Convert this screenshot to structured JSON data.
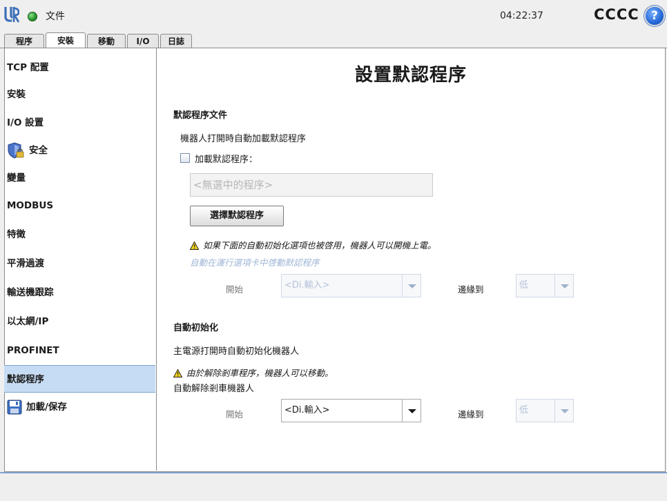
{
  "header": {
    "file_label": "文件",
    "clock": "04:22:37",
    "robot_name": "CCCC",
    "help_symbol": "?",
    "status_color": "#2b9a2f"
  },
  "tabs": [
    {
      "label": "程序",
      "active": false
    },
    {
      "label": "安裝",
      "active": true
    },
    {
      "label": "移動",
      "active": false
    },
    {
      "label": "I/O",
      "active": false
    },
    {
      "label": "日誌",
      "active": false
    }
  ],
  "sidebar": {
    "items": [
      {
        "label": "TCP 配置"
      },
      {
        "label": "安裝"
      },
      {
        "label": "I/O 設置"
      },
      {
        "label": "安全",
        "icon": "shield-lock-icon"
      },
      {
        "label": "變量"
      },
      {
        "label": "MODBUS"
      },
      {
        "label": "特徵"
      },
      {
        "label": "平滑過渡"
      },
      {
        "label": "輸送機跟踪"
      },
      {
        "label": "以太網/IP"
      },
      {
        "label": "PROFINET"
      },
      {
        "label": "默認程序",
        "selected": true
      },
      {
        "label": "加載/保存",
        "icon": "floppy-disk-icon"
      }
    ]
  },
  "main": {
    "title": "設置默認程序",
    "default_file": {
      "section_title": "默認程序文件",
      "description": "機器人打開時自動加載默認程序",
      "load_checkbox_label": "加載默認程序：",
      "load_checked": false,
      "program_placeholder": "<無選中的程序>",
      "select_button": "選擇默認程序",
      "warning": "如果下面的自動初始化選項也被啓用，機器人可以開機上電。",
      "auto_start_label": "自動在運行選項卡中啓動默認程序",
      "start_label": "開始",
      "start_input": "<Di.輸入>",
      "edge_label": "邊緣到",
      "edge_value": "低"
    },
    "auto_init": {
      "section_title": "自動初始化",
      "description": "主電源打開時自動初始化機器人",
      "warning": "由於解除剎車程序，機器人可以移動。",
      "brake_label": "自動解除剎車機器人",
      "start_label": "開始",
      "start_input": "<Di.輸入>",
      "edge_label": "邊緣到",
      "edge_value": "低"
    }
  }
}
